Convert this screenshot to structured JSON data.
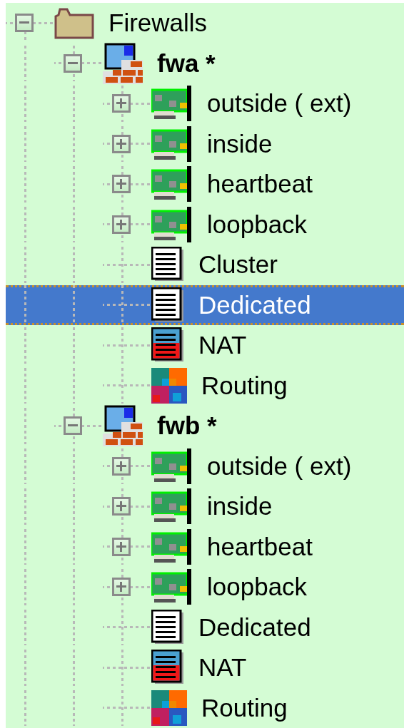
{
  "tree": [
    {
      "label": "Firewalls",
      "kind": "folder",
      "bold": false,
      "selected": false,
      "expanded": true,
      "children": [
        {
          "label": "fwa *",
          "kind": "firewall",
          "bold": true,
          "selected": false,
          "expanded": true,
          "children": [
            {
              "label": "outside ( ext)",
              "kind": "interface",
              "bold": false,
              "selected": false,
              "expanded": false
            },
            {
              "label": "inside",
              "kind": "interface",
              "bold": false,
              "selected": false,
              "expanded": false
            },
            {
              "label": "heartbeat",
              "kind": "interface",
              "bold": false,
              "selected": false,
              "expanded": false
            },
            {
              "label": "loopback",
              "kind": "interface",
              "bold": false,
              "selected": false,
              "expanded": false
            },
            {
              "label": "Cluster",
              "kind": "policy",
              "bold": false,
              "selected": false
            },
            {
              "label": "Dedicated",
              "kind": "policy",
              "bold": false,
              "selected": true
            },
            {
              "label": "NAT",
              "kind": "nat",
              "bold": false,
              "selected": false
            },
            {
              "label": "Routing",
              "kind": "routing",
              "bold": false,
              "selected": false
            }
          ]
        },
        {
          "label": "fwb *",
          "kind": "firewall",
          "bold": true,
          "selected": false,
          "expanded": true,
          "children": [
            {
              "label": "outside ( ext)",
              "kind": "interface",
              "bold": false,
              "selected": false,
              "expanded": false
            },
            {
              "label": "inside",
              "kind": "interface",
              "bold": false,
              "selected": false,
              "expanded": false
            },
            {
              "label": "heartbeat",
              "kind": "interface",
              "bold": false,
              "selected": false,
              "expanded": false
            },
            {
              "label": "loopback",
              "kind": "interface",
              "bold": false,
              "selected": false,
              "expanded": false
            },
            {
              "label": "Dedicated",
              "kind": "policy",
              "bold": false,
              "selected": false
            },
            {
              "label": "NAT",
              "kind": "nat",
              "bold": false,
              "selected": false
            },
            {
              "label": "Routing",
              "kind": "routing",
              "bold": false,
              "selected": false
            }
          ]
        }
      ]
    }
  ]
}
